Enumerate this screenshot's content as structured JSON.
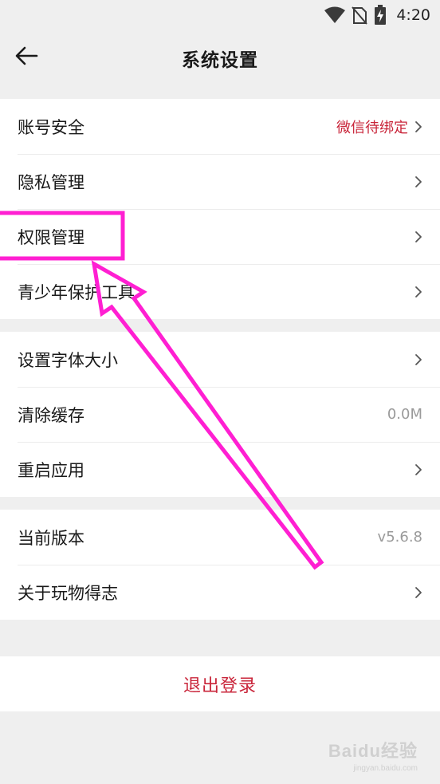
{
  "status_bar": {
    "time": "4:20",
    "icons": [
      "wifi-icon",
      "no-sim-icon",
      "battery-charging-icon"
    ]
  },
  "header": {
    "title": "系统设置",
    "back_icon": "back-arrow-icon"
  },
  "groups": [
    {
      "rows": [
        {
          "label": "账号安全",
          "value": "微信待绑定",
          "value_color": "#c9253a",
          "chevron": true
        },
        {
          "label": "隐私管理",
          "value": "",
          "chevron": true
        },
        {
          "label": "权限管理",
          "value": "",
          "chevron": true
        },
        {
          "label": "青少年保护工具",
          "value": "",
          "chevron": true
        }
      ]
    },
    {
      "rows": [
        {
          "label": "设置字体大小",
          "value": "",
          "chevron": true
        },
        {
          "label": "清除缓存",
          "value": "0.0M",
          "chevron": false
        },
        {
          "label": "重启应用",
          "value": "",
          "chevron": true
        }
      ]
    },
    {
      "rows": [
        {
          "label": "当前版本",
          "value": "v5.6.8",
          "chevron": false
        },
        {
          "label": "关于玩物得志",
          "value": "",
          "chevron": true
        }
      ]
    }
  ],
  "logout": {
    "label": "退出登录"
  },
  "annotation": {
    "color": "#ff1fd2"
  },
  "watermark": {
    "main": "Baidu经验",
    "sub": "jingyan.baidu.com"
  },
  "colors": {
    "background": "#efefef",
    "accent": "#c9253a",
    "muted": "#9a9a9a"
  }
}
